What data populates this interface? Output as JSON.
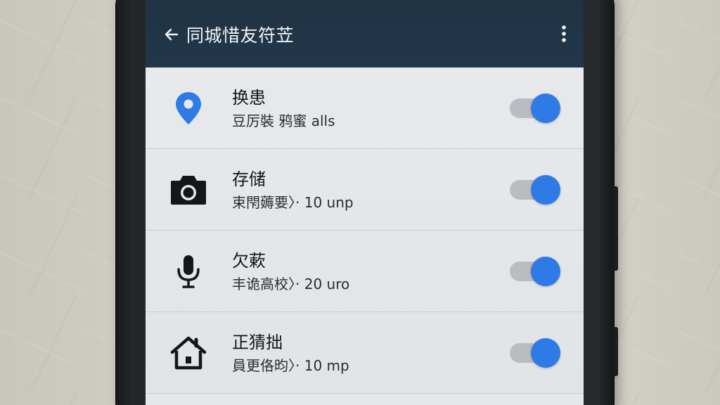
{
  "app_bar": {
    "title": "同城惜友符苙",
    "back_icon": "arrow-left-icon",
    "menu_icon": "more-vert-icon",
    "background": "#223749"
  },
  "permissions": [
    {
      "icon": "location-pin-icon",
      "label": "换患",
      "sub": "豆厉裝 鸦蜜 alls",
      "enabled": true
    },
    {
      "icon": "camera-icon",
      "label": "存储",
      "sub": "束閇薅要〉· 10 unp",
      "enabled": true
    },
    {
      "icon": "microphone-icon",
      "label": "欠蔌",
      "sub": "丰诡高校〉· 20 uro",
      "enabled": true
    },
    {
      "icon": "home-icon",
      "label": "正猜拙",
      "sub": "員更佫昀〉· 10 mp",
      "enabled": true
    }
  ],
  "colors": {
    "accent": "#2f7be6",
    "track": "#b9bcc1",
    "location_icon": "#2f7be6"
  }
}
